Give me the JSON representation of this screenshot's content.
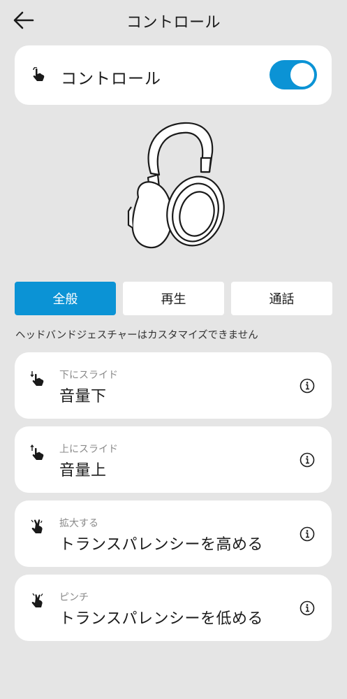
{
  "header": {
    "title": "コントロール",
    "back_icon": "arrow-left-icon"
  },
  "master": {
    "label": "コントロール",
    "icon": "hand-touch-icon",
    "toggle_on": true,
    "accent_color": "#0b93d5"
  },
  "tabs": [
    {
      "label": "全般",
      "active": true
    },
    {
      "label": "再生",
      "active": false
    },
    {
      "label": "通話",
      "active": false
    }
  ],
  "notice": "ヘッドバンドジェスチャーはカスタマイズできません",
  "gestures": [
    {
      "gesture": "下にスライド",
      "action": "音量下",
      "icon": "swipe-down-icon"
    },
    {
      "gesture": "上にスライド",
      "action": "音量上",
      "icon": "swipe-up-icon"
    },
    {
      "gesture": "拡大する",
      "action": "トランスパレンシーを高める",
      "icon": "spread-fingers-icon"
    },
    {
      "gesture": "ピンチ",
      "action": "トランスパレンシーを低める",
      "icon": "pinch-fingers-icon"
    }
  ]
}
